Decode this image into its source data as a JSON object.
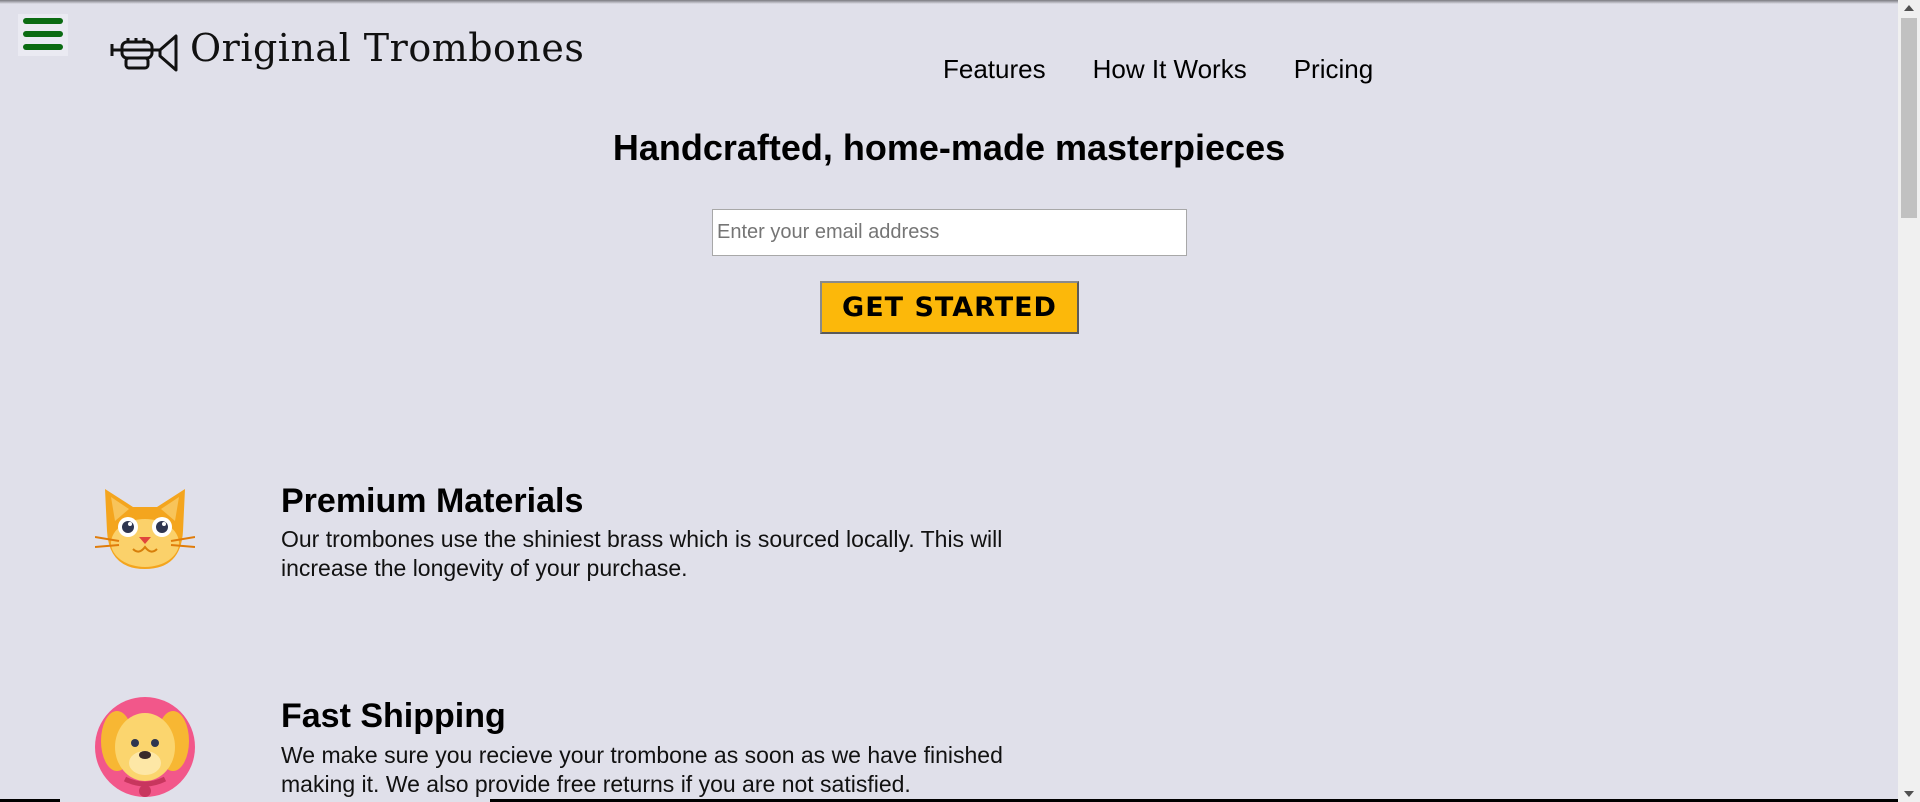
{
  "header": {
    "menu_icon": "hamburger-menu-icon",
    "logo_icon": "trumpet-icon",
    "logo_text": "Original Trombones",
    "nav": [
      {
        "label": "Features"
      },
      {
        "label": "How It Works"
      },
      {
        "label": "Pricing"
      }
    ]
  },
  "hero": {
    "title": "Handcrafted, home-made masterpieces",
    "email_placeholder": "Enter your email address",
    "email_value": "",
    "cta_label": "GET STARTED"
  },
  "features": [
    {
      "icon": "cat-face-icon",
      "title": "Premium Materials",
      "description": "Our trombones use the shiniest brass which is sourced locally. This will increase the longevity of your purchase."
    },
    {
      "icon": "dog-face-icon",
      "title": "Fast Shipping",
      "description": "We make sure you recieve your trombone as soon as we have finished making it. We also provide free returns if you are not satisfied."
    }
  ],
  "colors": {
    "background": "#e0e0ea",
    "menu_icon": "#0b6b12",
    "cta": "#fcb80a"
  }
}
